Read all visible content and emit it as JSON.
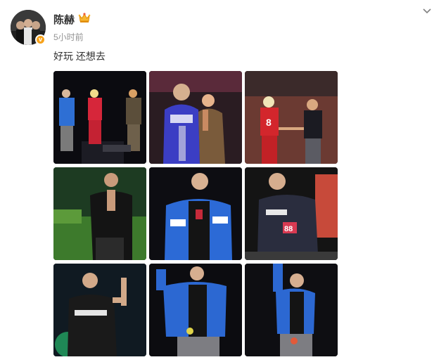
{
  "post": {
    "author": "陈赫",
    "timestamp": "5小时前",
    "text": "好玩 还想去",
    "badge": "v"
  },
  "icons": {
    "crown": "crown-icon",
    "menu": "chevron-down-icon",
    "verified": "verified-badge-icon"
  },
  "colors": {
    "badge": "#f7a21b",
    "username": "#333333",
    "timestamp": "#939393"
  },
  "photos": [
    {
      "name": "photo-1",
      "desc": "three performers on stage"
    },
    {
      "name": "photo-2",
      "desc": "singer with microphone and performer"
    },
    {
      "name": "photo-3",
      "desc": "two performers holding hands"
    },
    {
      "name": "photo-4",
      "desc": "singer in black outfit"
    },
    {
      "name": "photo-5",
      "desc": "singer in blue racing jacket"
    },
    {
      "name": "photo-6",
      "desc": "singer in racing jersey"
    },
    {
      "name": "photo-7",
      "desc": "singer raising arm"
    },
    {
      "name": "photo-8",
      "desc": "singer in blue jacket"
    },
    {
      "name": "photo-9",
      "desc": "singer raising arm in blue jacket"
    }
  ]
}
